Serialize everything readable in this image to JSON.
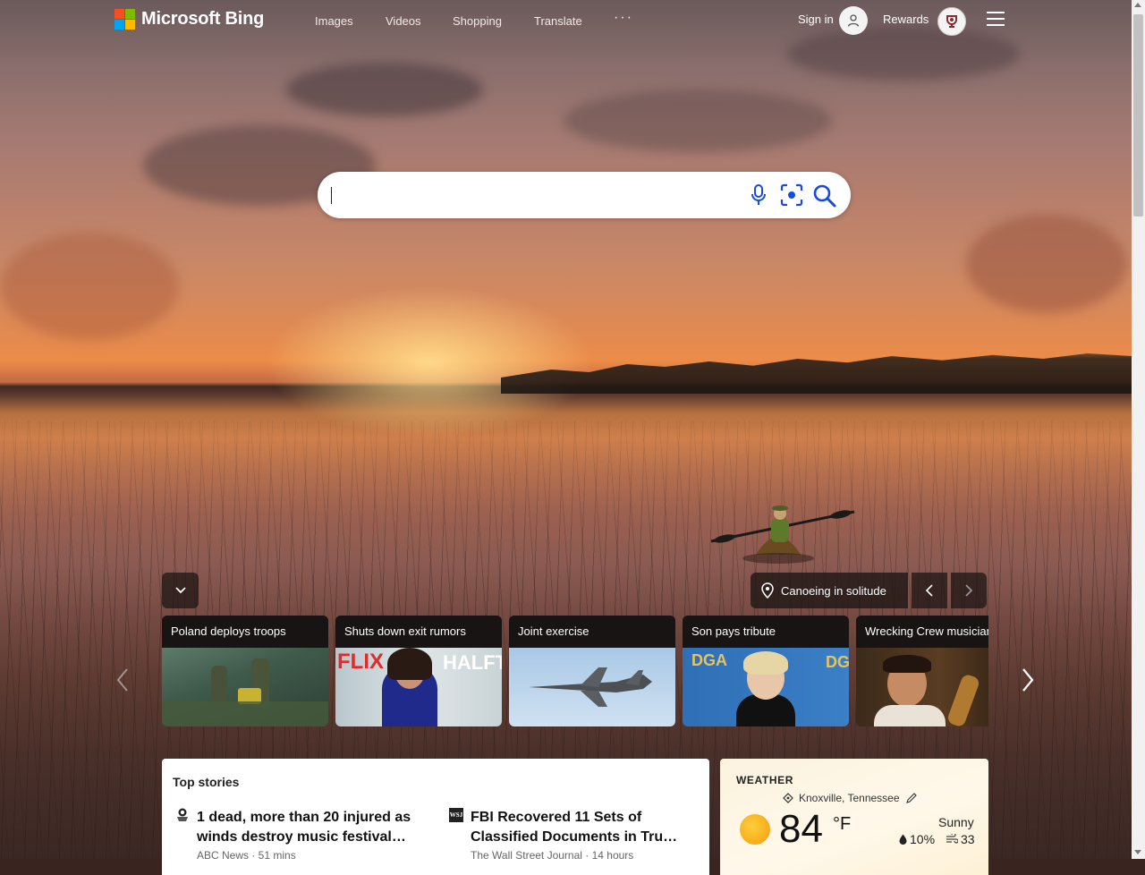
{
  "header": {
    "logo_text": "Microsoft Bing",
    "nav": [
      {
        "label": "Images"
      },
      {
        "label": "Videos"
      },
      {
        "label": "Shopping"
      },
      {
        "label": "Translate"
      }
    ],
    "more_label": "···",
    "signin_label": "Sign in",
    "rewards_label": "Rewards",
    "icons": [
      "user-avatar-icon",
      "rewards-trophy-icon",
      "hamburger-menu-icon"
    ]
  },
  "search": {
    "value": "",
    "placeholder": "",
    "icons": [
      "microphone-icon",
      "visual-search-icon",
      "search-icon"
    ]
  },
  "image_info": {
    "title": "Canoeing in solitude",
    "icons": [
      "location-pin-icon",
      "chevron-left-icon",
      "chevron-right-icon",
      "chevron-down-icon"
    ]
  },
  "news_cards": [
    {
      "title": "Poland deploys troops"
    },
    {
      "title": "Shuts down exit rumors"
    },
    {
      "title": "Joint exercise"
    },
    {
      "title": "Son pays tribute"
    },
    {
      "title": "Wrecking Crew musician"
    }
  ],
  "top_stories": {
    "heading": "Top stories",
    "stories": [
      {
        "title": "1 dead, more than 20 injured as winds destroy music festival…",
        "meta": "ABC News · 51 mins"
      },
      {
        "title": "FBI Recovered 11 Sets of Classified Documents in Tru…",
        "meta": "The Wall Street Journal · 14 hours"
      }
    ]
  },
  "weather": {
    "heading": "WEATHER",
    "location": "Knoxville, Tennessee",
    "temperature": "84",
    "unit": "°F",
    "condition": "Sunny",
    "precipitation": "10%",
    "air_quality": "33"
  },
  "colors": {
    "logo_red": "#f25022",
    "logo_green": "#7fba00",
    "logo_blue": "#00a4ef",
    "logo_yellow": "#ffb900",
    "search_icon_blue": "#174ae4"
  }
}
